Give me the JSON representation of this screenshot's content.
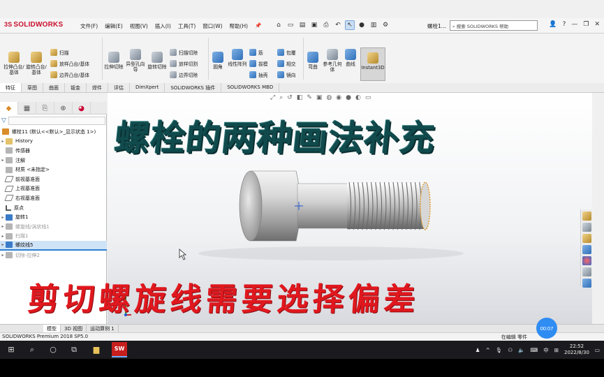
{
  "app": {
    "logo_text": "SOLIDWORKS",
    "doc_title": "螺栓1...",
    "help_placeholder": "搜索 SOLIDWORKS 帮助"
  },
  "menu": [
    "文件(F)",
    "编辑(E)",
    "视图(V)",
    "插入(I)",
    "工具(T)",
    "窗口(W)",
    "帮助(H)"
  ],
  "ribbon": {
    "extrude_boss": "拉伸凸台/基体",
    "revolve_boss": "旋转凸台/基体",
    "sweep": "扫描",
    "loft_boss": "放样凸台/基体",
    "boundary_boss": "边界凸台/基体",
    "extrude_cut": "拉伸切除",
    "hole_wizard": "异型孔向导",
    "revolve_cut": "旋转切除",
    "sweep_cut": "扫描切除",
    "loft_cut": "放样切割",
    "boundary_cut": "边界切除",
    "fillet": "圆角",
    "linear_pattern": "线性阵列",
    "rib": "筋",
    "draft": "拔模",
    "shell": "抽壳",
    "wrap": "包覆",
    "intersect": "相交",
    "mirror": "镜向",
    "flex": "弯曲",
    "ref_geometry": "参考几何体",
    "curves": "曲线",
    "instant3d": "Instant3D"
  },
  "cm_tabs": [
    "特征",
    "草图",
    "曲面",
    "钣金",
    "焊件",
    "评估",
    "DimXpert",
    "SOLIDWORKS 插件",
    "SOLIDWORKS MBD"
  ],
  "tree": {
    "root": "螺栓11 (默认<<默认>_显示状态 1>)",
    "items": [
      {
        "label": "History",
        "type": "folder"
      },
      {
        "label": "传感器",
        "type": "grey"
      },
      {
        "label": "注解",
        "type": "grey"
      },
      {
        "label": "材质 <未指定>",
        "type": "grey"
      },
      {
        "label": "前视基准面",
        "type": "plane"
      },
      {
        "label": "上视基准面",
        "type": "plane"
      },
      {
        "label": "右视基准面",
        "type": "plane"
      },
      {
        "label": "原点",
        "type": "grey"
      },
      {
        "label": "旋转1",
        "type": "blue"
      },
      {
        "label": "螺旋线/涡状线1",
        "type": "grey"
      },
      {
        "label": "扫描1",
        "type": "grey"
      },
      {
        "label": "螺纹线5",
        "type": "blue"
      },
      {
        "label": "切除-拉伸2",
        "type": "grey"
      }
    ]
  },
  "bottom_tabs": [
    "模型",
    "3D 视图",
    "运动算例 1"
  ],
  "status": {
    "left": "SOLIDWORKS Premium 2018 SP5.0",
    "right": "在编辑 零件"
  },
  "overlay": {
    "title_top": "螺栓的两种画法补充",
    "title_bottom": "剪切螺旋线需要选择偏差"
  },
  "timer": "00:07",
  "taskbar": {
    "app_label": "SW",
    "lang": "中",
    "time": "22:52",
    "date": "2022/8/30"
  },
  "colors": {
    "title_top": "#114a4c",
    "title_bottom": "#e0181e",
    "selection": "#cfe3f7",
    "logo_red": "#c8102e"
  }
}
